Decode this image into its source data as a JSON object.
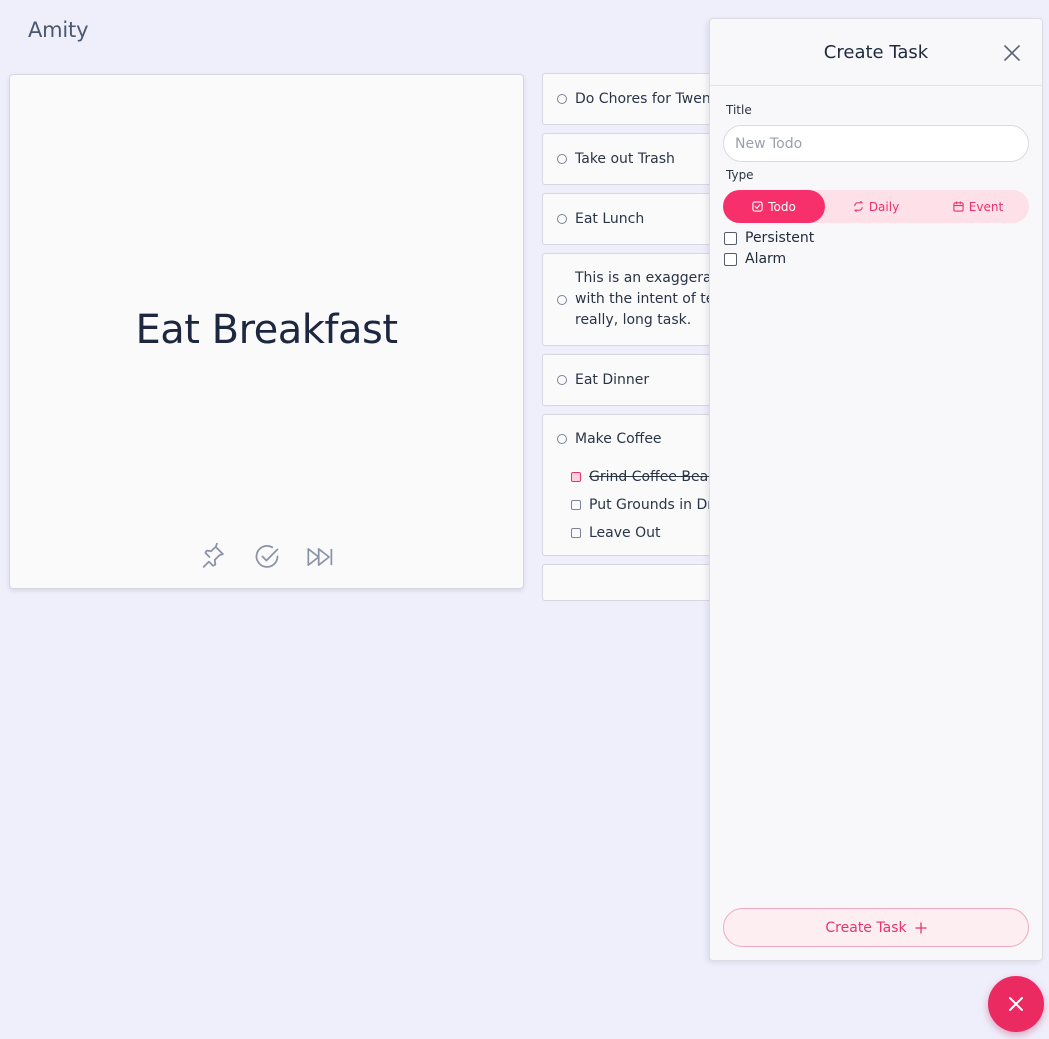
{
  "app": {
    "title": "Amity"
  },
  "focus": {
    "title": "Eat Breakfast"
  },
  "tasks": {
    "t1": "Do Chores for Twenty Minutes",
    "t2": "Take out Trash",
    "t3": "Eat Lunch",
    "t4_line1": "This is an exaggeratedly",
    "t4_line2": "with the intent of testing",
    "t4_line3": "really, long task.",
    "t5": "Eat Dinner",
    "t6": "Make Coffee",
    "t6_sub1": "Grind Coffee Beans",
    "t6_sub2": "Put Grounds in Drip",
    "t6_sub3": "Leave Out"
  },
  "panel": {
    "title": "Create Task",
    "title_label": "Title",
    "title_placeholder": "New Todo",
    "type_label": "Type",
    "type_options": {
      "todo": "Todo",
      "daily": "Daily",
      "event": "Event"
    },
    "persistent_label": "Persistent",
    "alarm_label": "Alarm",
    "create_label": "Create Task"
  },
  "colors": {
    "accent": "#ec2a62",
    "background": "#efeffc"
  }
}
